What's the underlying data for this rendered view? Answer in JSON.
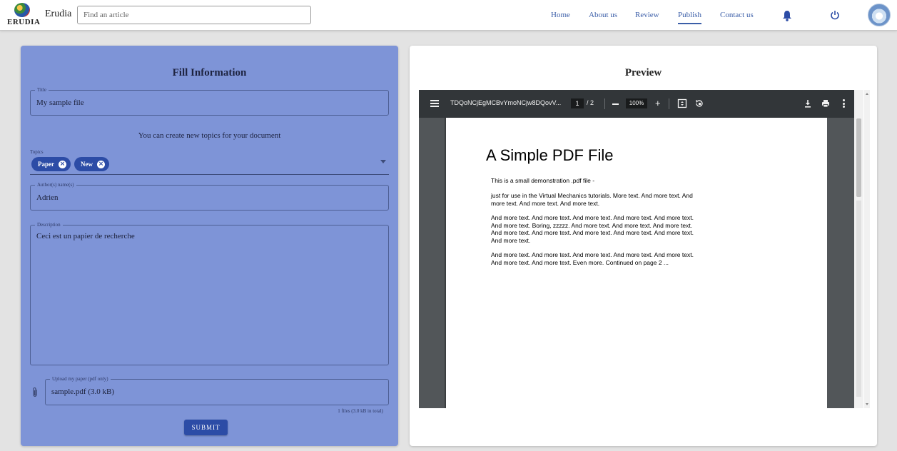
{
  "navbar": {
    "logo_text": "ERUDIA",
    "brand": "Erudia",
    "search_placeholder": "Find an article",
    "links": [
      "Home",
      "About us",
      "Review",
      "Publish",
      "Contact us"
    ],
    "active_link": "Publish",
    "icons": [
      "bell-icon",
      "power-icon",
      "avatar"
    ],
    "accent_color": "#3b5ea8"
  },
  "form": {
    "heading": "Fill Information",
    "title_label": "Title",
    "title_value": "My sample file",
    "topics_helper": "You can create new topics for your document",
    "topics_label": "Topics",
    "topics": [
      "Paper",
      "New"
    ],
    "authors_label": "Author(s) name(s)",
    "authors_value": "Adrien",
    "description_label": "Description",
    "description_value": "Ceci est un papier de recherche",
    "upload_label": "Upload my paper (pdf only)",
    "upload_value": "sample.pdf (3.0 kB)",
    "files_summary": "1 files (3.0 kB in total)",
    "submit_label": "SUBMIT",
    "card_color": "#7e94d7",
    "button_color": "#2c4ca6"
  },
  "preview": {
    "heading": "Preview",
    "toolbar": {
      "filename": "TDQoNCjEgMCBvYmoNCjw8DQovV...",
      "current_page": "1",
      "total_pages": "/ 2",
      "zoom": "100%"
    },
    "pdf": {
      "title": "A Simple PDF File",
      "paragraphs": [
        "This is a small demonstration .pdf file -",
        "just for use in the Virtual Mechanics tutorials. More text. And more text. And more text. And more text. And more text.",
        "And more text. And more text. And more text. And more text. And more text. And more text. Boring, zzzzz. And more text. And more text. And more text. And more text. And more text. And more text. And more text. And more text. And more text.",
        "And more text. And more text. And more text. And more text. And more text. And more text. And more text. Even more. Continued on page 2 ..."
      ]
    }
  }
}
